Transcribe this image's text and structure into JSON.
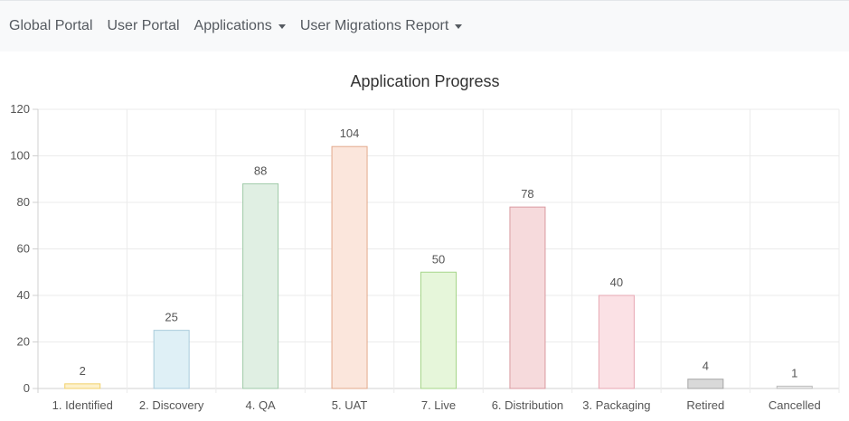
{
  "nav": {
    "items": [
      {
        "label": "Global Portal",
        "dropdown": false
      },
      {
        "label": "User Portal",
        "dropdown": false
      },
      {
        "label": "Applications",
        "dropdown": true
      },
      {
        "label": "User Migrations Report",
        "dropdown": true
      }
    ]
  },
  "chart_data": {
    "type": "bar",
    "title": "Application Progress",
    "xlabel": "",
    "ylabel": "",
    "categories": [
      "1. Identified",
      "2. Discovery",
      "4. QA",
      "5. UAT",
      "7. Live",
      "6. Distribution",
      "3. Packaging",
      "Retired",
      "Cancelled"
    ],
    "values": [
      2,
      25,
      88,
      104,
      50,
      78,
      40,
      4,
      1
    ],
    "ylim": [
      0,
      120
    ],
    "yticks": [
      0,
      20,
      40,
      60,
      80,
      100,
      120
    ],
    "grid": true,
    "data_labels": true,
    "colors": {
      "fill": [
        "#fdf1cc",
        "#dff0f6",
        "#e0efe3",
        "#fbe6dc",
        "#e6f6da",
        "#f6dadc",
        "#fbe1e5",
        "#d9d9d9",
        "#ececec"
      ],
      "stroke": [
        "#f2d16b",
        "#a9cbdc",
        "#9fcaa8",
        "#e3a98c",
        "#a6d58a",
        "#d99aa0",
        "#e7a7b3",
        "#a6a6a6",
        "#bcbcbc"
      ],
      "grid": "#ebebeb",
      "axis": "#d0d0d0"
    }
  }
}
